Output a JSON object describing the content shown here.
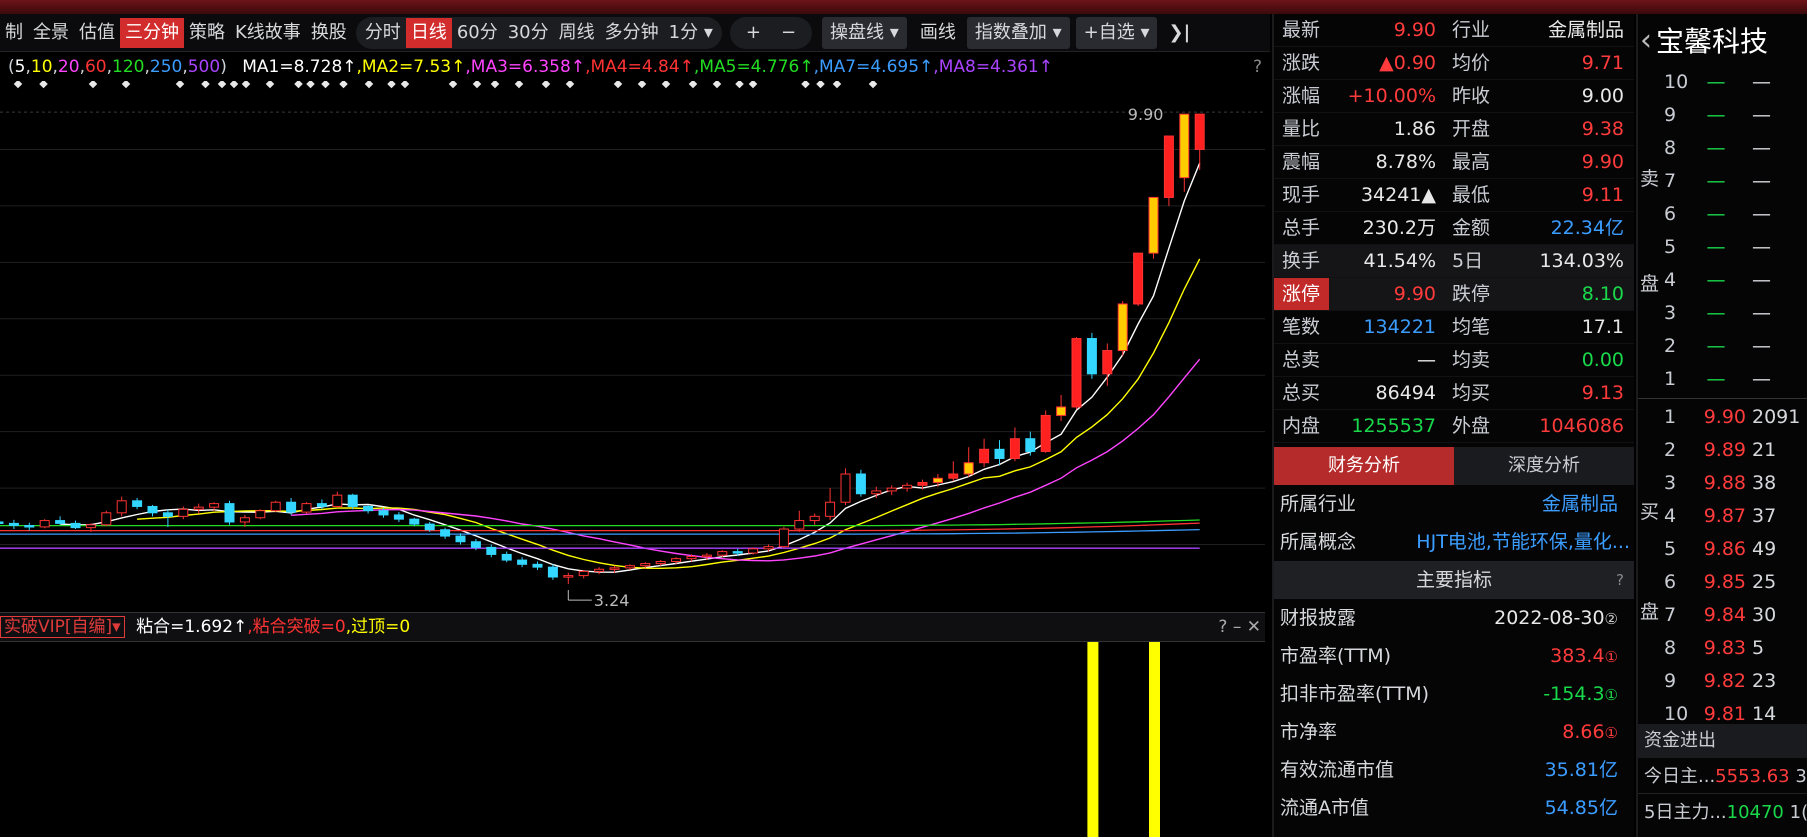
{
  "toolbar": {
    "tabs": [
      "制",
      "全景",
      "估值",
      "三分钟",
      "策略",
      "K线故事",
      "换股"
    ],
    "active_tab": "三分钟",
    "periods": [
      "分时",
      "日线",
      "60分",
      "30分",
      "周线",
      "多分钟"
    ],
    "active_period": "日线",
    "minute_select": "1分",
    "plus": "+",
    "minus": "−",
    "draw_line": "操盘线",
    "draw": "画线",
    "index_overlay": "指数叠加",
    "watchlist": "+自选",
    "close_glyph": "❯|"
  },
  "ma_legend": {
    "periods_prefix": "(",
    "periods": [
      "5",
      "10",
      "20",
      "60",
      "120",
      "250",
      "500"
    ],
    "periods_suffix": ")",
    "items": [
      {
        "label": "MA1=8.728↑",
        "color": "#ffffff"
      },
      {
        "label": ",MA2=7.53↑",
        "color": "#ffff00"
      },
      {
        "label": ",MA3=6.358↑",
        "color": "#ff44ff"
      },
      {
        "label": ",MA4=4.84↑",
        "color": "#ff3333"
      },
      {
        "label": ",MA5=4.776↑",
        "color": "#22dd22"
      },
      {
        "label": ",MA7=4.695↑",
        "color": "#3b9dff"
      },
      {
        "label": ",MA8=4.361↑",
        "color": "#aa44ff"
      }
    ],
    "help": "?"
  },
  "chart": {
    "high_label": "9.90",
    "low_label": "3.24"
  },
  "indicator": {
    "name": "实破VIP[自编]",
    "values": [
      {
        "label": "粘合=1.692↑",
        "color": "#ffffff"
      },
      {
        "label": ",粘合突破=0",
        "color": "#ff3333"
      },
      {
        "label": ",过顶=0",
        "color": "#ffff00"
      }
    ],
    "controls": [
      "?",
      "–",
      "✕"
    ]
  },
  "chart_data": {
    "type": "candlestick",
    "ymin": 3.0,
    "ymax": 10.2,
    "candles": [
      [
        4.12,
        4.18,
        4.04,
        4.1
      ],
      [
        4.1,
        4.15,
        4.02,
        4.07
      ],
      [
        4.07,
        4.11,
        4.0,
        4.05
      ],
      [
        4.05,
        4.16,
        4.03,
        4.14
      ],
      [
        4.14,
        4.2,
        4.08,
        4.1
      ],
      [
        4.1,
        4.14,
        4.02,
        4.04
      ],
      [
        4.04,
        4.1,
        3.98,
        4.08
      ],
      [
        4.08,
        4.28,
        4.06,
        4.25
      ],
      [
        4.25,
        4.48,
        4.2,
        4.42
      ],
      [
        4.42,
        4.46,
        4.3,
        4.34
      ],
      [
        4.34,
        4.36,
        4.2,
        4.25
      ],
      [
        4.25,
        4.3,
        4.05,
        4.2
      ],
      [
        4.2,
        4.34,
        4.16,
        4.3
      ],
      [
        4.3,
        4.38,
        4.24,
        4.33
      ],
      [
        4.33,
        4.4,
        4.28,
        4.38
      ],
      [
        4.38,
        4.42,
        4.08,
        4.12
      ],
      [
        4.12,
        4.22,
        4.05,
        4.18
      ],
      [
        4.18,
        4.3,
        4.16,
        4.28
      ],
      [
        4.28,
        4.42,
        4.26,
        4.4
      ],
      [
        4.4,
        4.46,
        4.22,
        4.26
      ],
      [
        4.26,
        4.4,
        4.24,
        4.38
      ],
      [
        4.38,
        4.44,
        4.3,
        4.34
      ],
      [
        4.34,
        4.55,
        4.32,
        4.5
      ],
      [
        4.5,
        4.52,
        4.3,
        4.34
      ],
      [
        4.34,
        4.36,
        4.24,
        4.28
      ],
      [
        4.28,
        4.32,
        4.18,
        4.22
      ],
      [
        4.22,
        4.26,
        4.12,
        4.16
      ],
      [
        4.16,
        4.18,
        4.06,
        4.09
      ],
      [
        4.09,
        4.12,
        3.98,
        4.01
      ],
      [
        4.01,
        4.04,
        3.88,
        3.92
      ],
      [
        3.92,
        3.96,
        3.8,
        3.84
      ],
      [
        3.84,
        3.88,
        3.72,
        3.76
      ],
      [
        3.76,
        3.8,
        3.62,
        3.66
      ],
      [
        3.66,
        3.7,
        3.55,
        3.58
      ],
      [
        3.58,
        3.62,
        3.48,
        3.52
      ],
      [
        3.52,
        3.56,
        3.44,
        3.48
      ],
      [
        3.48,
        3.52,
        3.3,
        3.34
      ],
      [
        3.34,
        3.4,
        3.24,
        3.36
      ],
      [
        3.36,
        3.44,
        3.32,
        3.42
      ],
      [
        3.42,
        3.48,
        3.38,
        3.45
      ],
      [
        3.45,
        3.5,
        3.4,
        3.47
      ],
      [
        3.47,
        3.52,
        3.44,
        3.5
      ],
      [
        3.5,
        3.55,
        3.46,
        3.53
      ],
      [
        3.53,
        3.58,
        3.5,
        3.56
      ],
      [
        3.56,
        3.62,
        3.52,
        3.6
      ],
      [
        3.6,
        3.66,
        3.56,
        3.63
      ],
      [
        3.63,
        3.68,
        3.58,
        3.65
      ],
      [
        3.65,
        3.72,
        3.62,
        3.7
      ],
      [
        3.7,
        3.74,
        3.64,
        3.68
      ],
      [
        3.68,
        3.76,
        3.66,
        3.74
      ],
      [
        3.74,
        3.8,
        3.7,
        3.77
      ],
      [
        3.77,
        4.05,
        3.75,
        4.02
      ],
      [
        4.02,
        4.28,
        3.98,
        4.14
      ],
      [
        4.14,
        4.24,
        4.08,
        4.2
      ],
      [
        4.2,
        4.6,
        4.15,
        4.4
      ],
      [
        4.4,
        4.88,
        4.36,
        4.8
      ],
      [
        4.8,
        4.86,
        4.48,
        4.52
      ],
      [
        4.52,
        4.62,
        4.46,
        4.56
      ],
      [
        4.56,
        4.64,
        4.5,
        4.6
      ],
      [
        4.6,
        4.68,
        4.55,
        4.64
      ],
      [
        4.64,
        4.72,
        4.58,
        4.68
      ],
      [
        4.68,
        4.8,
        4.62,
        4.74
      ],
      [
        4.74,
        4.98,
        4.7,
        4.8
      ],
      [
        4.8,
        5.18,
        4.76,
        4.96
      ],
      [
        4.96,
        5.3,
        4.9,
        5.15
      ],
      [
        5.15,
        5.28,
        4.92,
        5.02
      ],
      [
        5.02,
        5.46,
        4.98,
        5.3
      ],
      [
        5.3,
        5.4,
        5.06,
        5.12
      ],
      [
        5.12,
        5.7,
        5.1,
        5.63
      ],
      [
        5.63,
        5.92,
        5.55,
        5.75
      ],
      [
        5.75,
        6.74,
        5.72,
        6.72
      ],
      [
        6.72,
        6.8,
        6.15,
        6.22
      ],
      [
        6.22,
        6.65,
        6.05,
        6.55
      ],
      [
        6.55,
        7.25,
        6.48,
        7.21
      ],
      [
        7.21,
        7.93,
        7.18,
        7.93
      ],
      [
        7.93,
        8.72,
        7.85,
        8.72
      ],
      [
        8.72,
        9.59,
        8.6,
        9.59
      ],
      [
        9.0,
        9.9,
        8.8,
        9.9
      ],
      [
        9.4,
        9.9,
        9.11,
        9.9
      ]
    ]
  },
  "quote": {
    "rows": [
      {
        "l1": "最新",
        "v1": "9.90",
        "c1": "red",
        "l2": "行业",
        "v2": "金属制品",
        "c2": "white"
      },
      {
        "l1": "涨跌",
        "v1": "▲0.90",
        "c1": "red",
        "l2": "均价",
        "v2": "9.71",
        "c2": "red"
      },
      {
        "l1": "涨幅",
        "v1": "+10.00%",
        "c1": "red",
        "l2": "昨收",
        "v2": "9.00",
        "c2": "white"
      },
      {
        "l1": "量比",
        "v1": "1.86",
        "c1": "white",
        "l2": "开盘",
        "v2": "9.38",
        "c2": "red"
      },
      {
        "l1": "震幅",
        "v1": "8.78%",
        "c1": "white",
        "l2": "最高",
        "v2": "9.90",
        "c2": "red"
      },
      {
        "l1": "现手",
        "v1": "34241▲",
        "c1": "white",
        "l2": "最低",
        "v2": "9.11",
        "c2": "red"
      },
      {
        "l1": "总手",
        "v1": "230.2万",
        "c1": "white",
        "l2": "金额",
        "v2": "22.34亿",
        "c2": "blue"
      },
      {
        "l1": "换手",
        "v1": "41.54%",
        "c1": "white",
        "l2": "5日",
        "v2": "134.03%",
        "c2": "white"
      },
      {
        "l1": "涨停",
        "v1": "9.90",
        "c1": "red",
        "l2": "跌停",
        "v2": "8.10",
        "c2": "green"
      },
      {
        "l1": "笔数",
        "v1": "134221",
        "c1": "blue",
        "l2": "均笔",
        "v2": "17.1",
        "c2": "white"
      },
      {
        "l1": "总卖",
        "v1": "—",
        "c1": "white",
        "l2": "均卖",
        "v2": "0.00",
        "c2": "green"
      },
      {
        "l1": "总买",
        "v1": "86494",
        "c1": "white",
        "l2": "均买",
        "v2": "9.13",
        "c2": "red"
      },
      {
        "l1": "内盘",
        "v1": "1255537",
        "c1": "green",
        "l2": "外盘",
        "v2": "1046086",
        "c2": "red"
      }
    ],
    "tabs": [
      "财务分析",
      "深度分析"
    ],
    "industry_label": "所属行业",
    "industry_value": "金属制品",
    "concept_label": "所属概念",
    "concept_value": "HJT电池,节能环保,量化...",
    "section_title": "主要指标",
    "section_help": "?",
    "fin_rows": [
      {
        "label": "财报披露",
        "value": "2022-08-30",
        "mark": "②",
        "color": "white"
      },
      {
        "label": "市盈率(TTM)",
        "value": "383.4",
        "mark": "①",
        "color": "red"
      },
      {
        "label": "扣非市盈率(TTM)",
        "value": "-154.3",
        "mark": "①",
        "color": "green"
      },
      {
        "label": "市净率",
        "value": "8.66",
        "mark": "①",
        "color": "red"
      },
      {
        "label": "有效流通市值",
        "value": "35.81亿",
        "mark": "",
        "color": "blue"
      },
      {
        "label": "流通A市值",
        "value": "54.85亿",
        "mark": "",
        "color": "blue"
      }
    ]
  },
  "orderbook": {
    "title": "宝馨科技",
    "back": "‹",
    "sell_side": "卖",
    "sell_side2": "盘",
    "buy_side": "买",
    "buy_side2": "盘",
    "sells": [
      {
        "lvl": "10",
        "price": "—",
        "vol": "—"
      },
      {
        "lvl": "9",
        "price": "—",
        "vol": "—"
      },
      {
        "lvl": "8",
        "price": "—",
        "vol": "—"
      },
      {
        "lvl": "7",
        "price": "—",
        "vol": "—"
      },
      {
        "lvl": "6",
        "price": "—",
        "vol": "—"
      },
      {
        "lvl": "5",
        "price": "—",
        "vol": "—"
      },
      {
        "lvl": "4",
        "price": "—",
        "vol": "—"
      },
      {
        "lvl": "3",
        "price": "—",
        "vol": "—"
      },
      {
        "lvl": "2",
        "price": "—",
        "vol": "—"
      },
      {
        "lvl": "1",
        "price": "—",
        "vol": "—"
      }
    ],
    "buys": [
      {
        "lvl": "1",
        "price": "9.90",
        "vol": "2091"
      },
      {
        "lvl": "2",
        "price": "9.89",
        "vol": "21"
      },
      {
        "lvl": "3",
        "price": "9.88",
        "vol": "38"
      },
      {
        "lvl": "4",
        "price": "9.87",
        "vol": "37"
      },
      {
        "lvl": "5",
        "price": "9.86",
        "vol": "49"
      },
      {
        "lvl": "6",
        "price": "9.85",
        "vol": "25"
      },
      {
        "lvl": "7",
        "price": "9.84",
        "vol": "30"
      },
      {
        "lvl": "8",
        "price": "9.83",
        "vol": "5"
      },
      {
        "lvl": "9",
        "price": "9.82",
        "vol": "23"
      },
      {
        "lvl": "10",
        "price": "9.81",
        "vol": "14"
      }
    ],
    "fund_title": "资金进出",
    "fund_rows": [
      {
        "label": "今日主...",
        "value": "5553.63",
        "color": "red",
        "extra": "3"
      },
      {
        "label": "5日主力...",
        "value": "10470",
        "color": "green",
        "extra": "1("
      }
    ]
  }
}
